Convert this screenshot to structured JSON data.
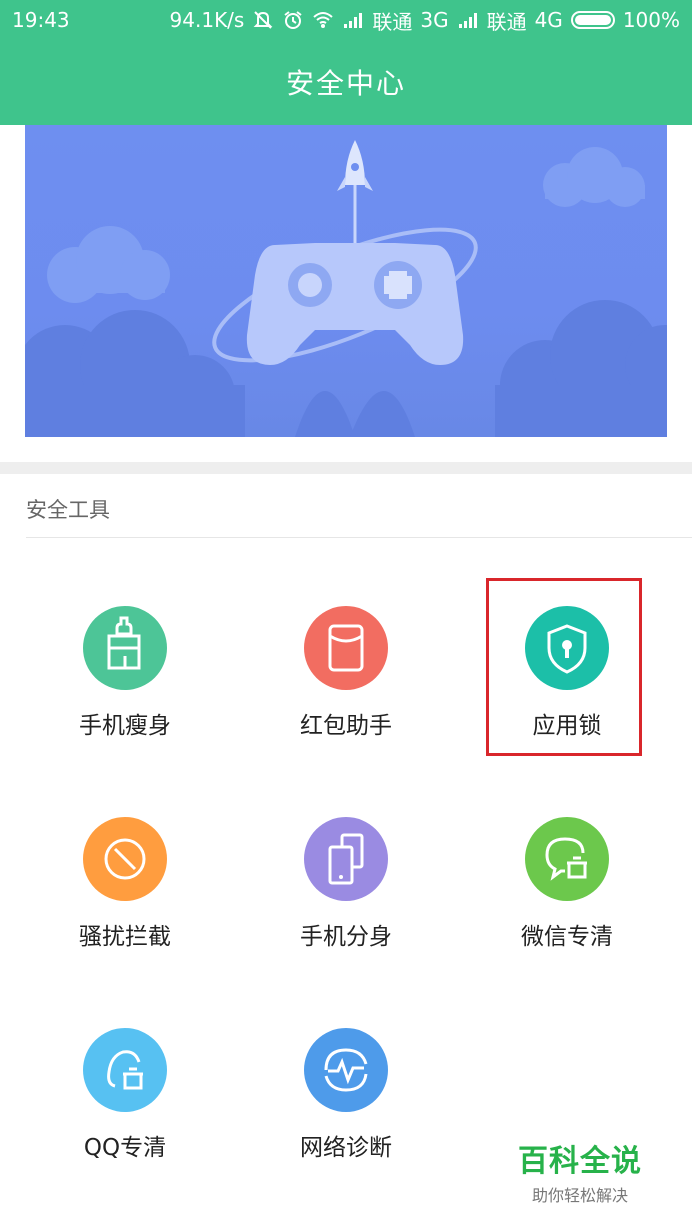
{
  "status_bar": {
    "time": "19:43",
    "speed": "94.1K/s",
    "carrier1": "联通",
    "network1": "3G",
    "carrier2": "联通",
    "network2": "4G",
    "battery": "100%"
  },
  "header": {
    "title": "安全中心",
    "color": "#3fc48c"
  },
  "banner": {
    "description_icon": "gamepad-rocket-illustration"
  },
  "section": {
    "title": "安全工具"
  },
  "tools": [
    {
      "label": "手机瘦身",
      "icon": "broom-icon",
      "color": "#4dc597"
    },
    {
      "label": "红包助手",
      "icon": "red-envelope-icon",
      "color": "#f26d61"
    },
    {
      "label": "应用锁",
      "icon": "shield-lock-icon",
      "color": "#1cbfa8"
    },
    {
      "label": "骚扰拦截",
      "icon": "block-icon",
      "color": "#ff9d3f"
    },
    {
      "label": "手机分身",
      "icon": "dual-phone-icon",
      "color": "#9a8be2"
    },
    {
      "label": "微信专清",
      "icon": "wechat-clean-icon",
      "color": "#6cc84c"
    },
    {
      "label": "QQ专清",
      "icon": "qq-clean-icon",
      "color": "#57c1f2"
    },
    {
      "label": "网络诊断",
      "icon": "network-pulse-icon",
      "color": "#4e9bea"
    }
  ],
  "watermark": {
    "main": "百科全说",
    "sub": "助你轻松解决"
  }
}
